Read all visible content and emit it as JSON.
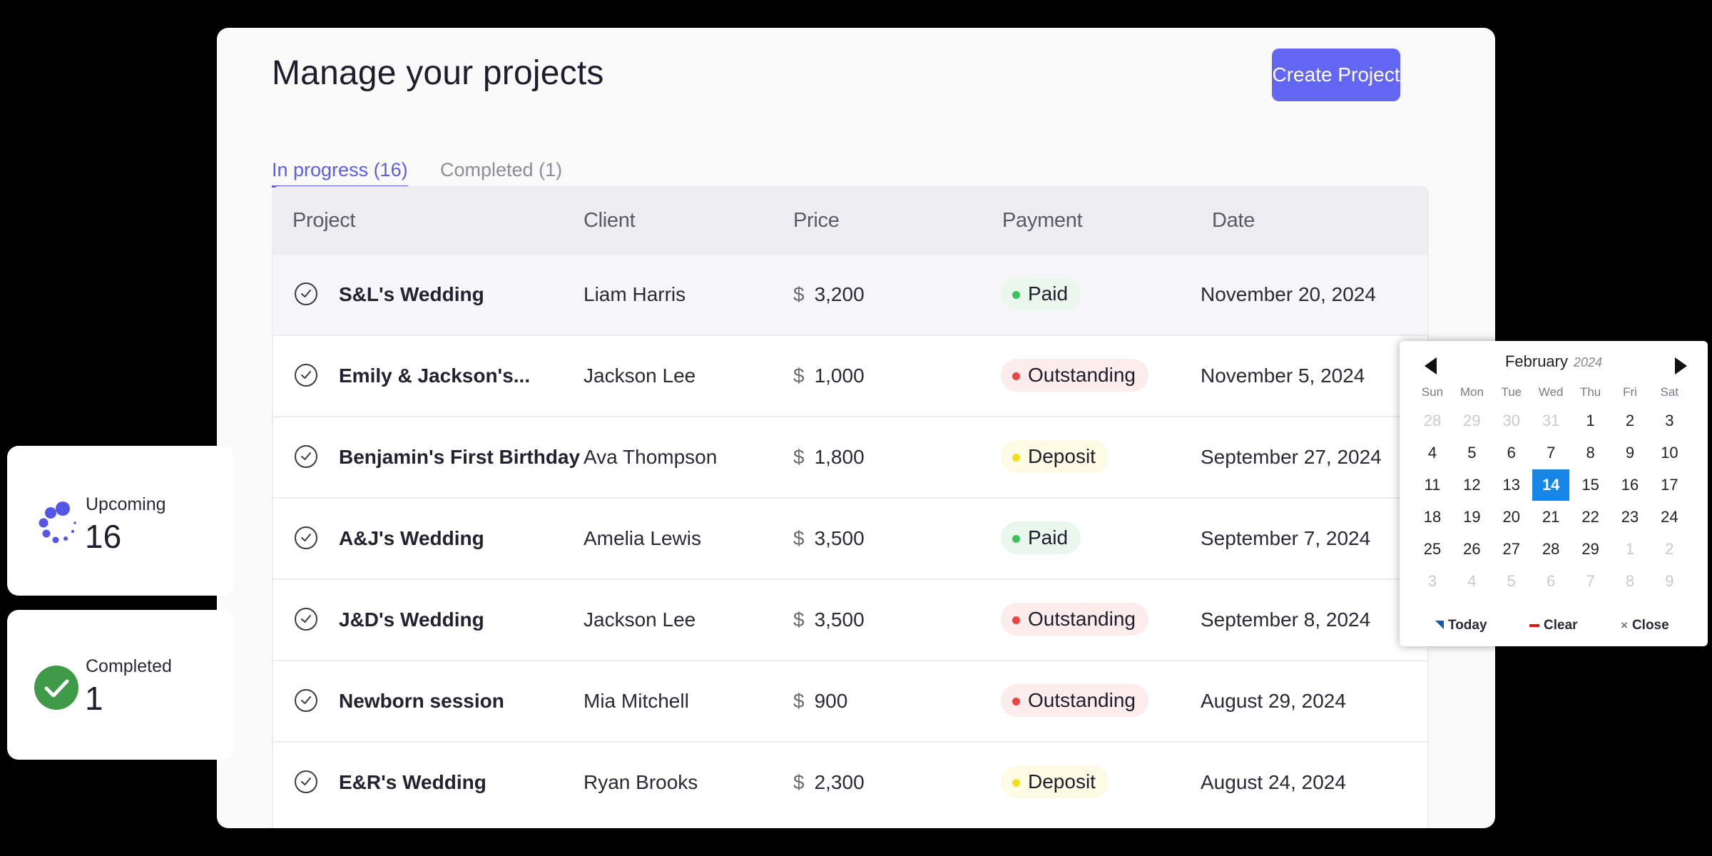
{
  "header": {
    "title": "Manage your projects",
    "create_label": "Create Project"
  },
  "tabs": [
    {
      "label": "In progress (16)"
    },
    {
      "label": "Completed (1)"
    }
  ],
  "table": {
    "columns": [
      "Project",
      "Client",
      "Price",
      "Payment",
      "Date"
    ],
    "currency_symbol": "$",
    "rows": [
      {
        "project": "S&L's Wedding",
        "client": "Liam Harris",
        "price": "3,200",
        "payment": "Paid",
        "date": "November 20, 2024"
      },
      {
        "project": "Emily & Jackson's...",
        "client": "Jackson Lee",
        "price": "1,000",
        "payment": "Outstanding",
        "date": "November 5, 2024"
      },
      {
        "project": "Benjamin's First Birthday",
        "client": "Ava Thompson",
        "price": "1,800",
        "payment": "Deposit",
        "date": "September 27, 2024"
      },
      {
        "project": "A&J's Wedding",
        "client": "Amelia Lewis",
        "price": "3,500",
        "payment": "Paid",
        "date": "September 7, 2024"
      },
      {
        "project": "J&D's Wedding",
        "client": "Jackson Lee",
        "price": "3,500",
        "payment": "Outstanding",
        "date": "September 8, 2024"
      },
      {
        "project": "Newborn session",
        "client": "Mia Mitchell",
        "price": "900",
        "payment": "Outstanding",
        "date": "August 29, 2024"
      },
      {
        "project": "E&R's Wedding",
        "client": "Ryan Brooks",
        "price": "2,300",
        "payment": "Deposit",
        "date": "August 24, 2024"
      }
    ]
  },
  "payment_colors": {
    "Paid": {
      "bg": "#e9f7ec",
      "dot": "#3cc25a"
    },
    "Outstanding": {
      "bg": "#fdecec",
      "dot": "#ee4444"
    },
    "Deposit": {
      "bg": "#fdfbe3",
      "dot": "#f2dd22"
    }
  },
  "stats": {
    "upcoming": {
      "label": "Upcoming",
      "value": "16"
    },
    "completed": {
      "label": "Completed",
      "value": "1"
    }
  },
  "calendar": {
    "month": "February",
    "year": "2024",
    "weekdays": [
      "Sun",
      "Mon",
      "Tue",
      "Wed",
      "Thu",
      "Fri",
      "Sat"
    ],
    "weeks": [
      [
        "28",
        "29",
        "30",
        "31",
        "1",
        "2",
        "3"
      ],
      [
        "4",
        "5",
        "6",
        "7",
        "8",
        "9",
        "10"
      ],
      [
        "11",
        "12",
        "13",
        "14",
        "15",
        "16",
        "17"
      ],
      [
        "18",
        "19",
        "20",
        "21",
        "22",
        "23",
        "24"
      ],
      [
        "25",
        "26",
        "27",
        "28",
        "29",
        "1",
        "2"
      ],
      [
        "3",
        "4",
        "5",
        "6",
        "7",
        "8",
        "9"
      ]
    ],
    "selected": "14",
    "footer": {
      "today": "Today",
      "clear": "Clear",
      "close": "Close"
    }
  },
  "colors": {
    "accent": "#6366f1",
    "selected_day": "#1586e8",
    "completed_check": "#3e9a46"
  }
}
